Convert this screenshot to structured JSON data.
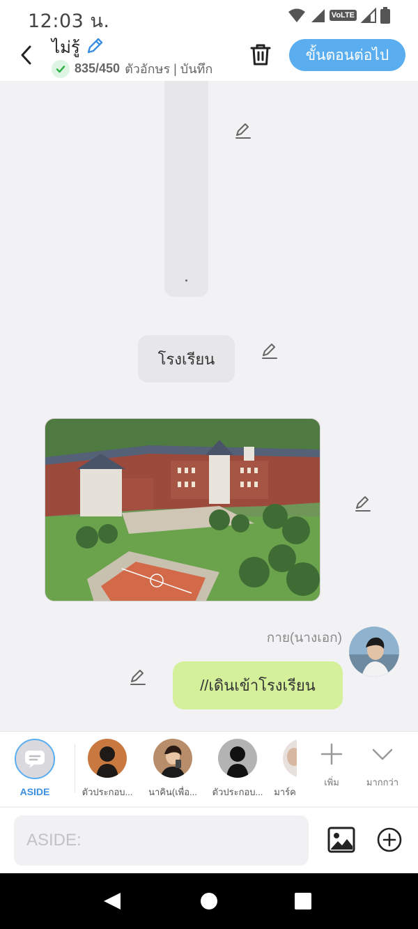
{
  "status_bar": {
    "time": "12:03 น.",
    "network_label": "VoLTE"
  },
  "header": {
    "title": "ไม่รู้",
    "char_count": "835/450",
    "meta_text": "ตัวอักษร | บันทึก",
    "next_label": "ขั้นตอนต่อไป"
  },
  "chat": {
    "location_text": "โรงเรียน",
    "speaker_name": "กาย(นางเอก)",
    "message_text": "//เดินเข้าโรงเรียน"
  },
  "characters": [
    {
      "label": "ASIDE"
    },
    {
      "label": "ตัวประกอบ..."
    },
    {
      "label": "นาคิน(เพื่อ..."
    },
    {
      "label": "ตัวประกอบ..."
    },
    {
      "label": "มาร์ค"
    }
  ],
  "strip_actions": {
    "add_label": "เพิ่ม",
    "more_label": "มากกว่า"
  },
  "input": {
    "placeholder": "ASIDE:"
  },
  "colors": {
    "accent": "#5aaef0",
    "message_bubble": "#d5f09a",
    "neutral_bubble": "#e7e7ea"
  }
}
